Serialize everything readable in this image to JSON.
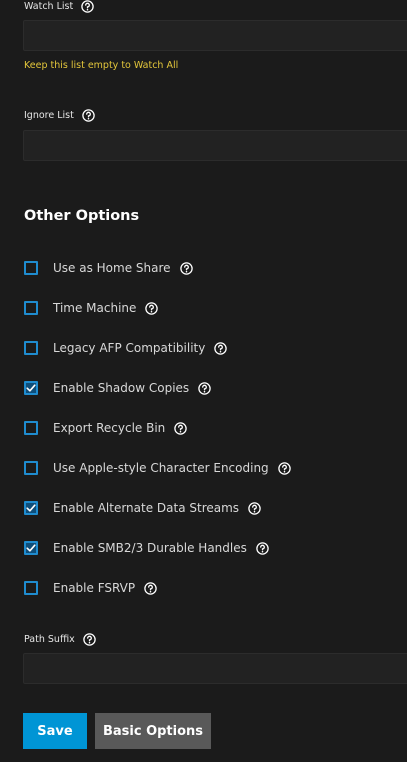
{
  "watch_list": {
    "label": "Watch List",
    "value": "",
    "hint": "Keep this list empty to Watch All"
  },
  "ignore_list": {
    "label": "Ignore List",
    "value": ""
  },
  "other_options": {
    "title": "Other Options",
    "items": [
      {
        "label": "Use as Home Share",
        "checked": false
      },
      {
        "label": "Time Machine",
        "checked": false
      },
      {
        "label": "Legacy AFP Compatibility",
        "checked": false
      },
      {
        "label": "Enable Shadow Copies",
        "checked": true
      },
      {
        "label": "Export Recycle Bin",
        "checked": false
      },
      {
        "label": "Use Apple-style Character Encoding",
        "checked": false
      },
      {
        "label": "Enable Alternate Data Streams",
        "checked": true
      },
      {
        "label": "Enable SMB2/3 Durable Handles",
        "checked": true
      },
      {
        "label": "Enable FSRVP",
        "checked": false
      }
    ]
  },
  "path_suffix": {
    "label": "Path Suffix",
    "value": ""
  },
  "actions": {
    "save_label": "Save",
    "basic_options_label": "Basic Options"
  },
  "colors": {
    "background": "#1b1b1b",
    "input_background": "#222222",
    "accent": "#0095d5",
    "checkbox_border": "#1f8ccf",
    "hint": "#e3c63b",
    "secondary_button": "#595959"
  },
  "icons": {
    "help": "help-circle-icon",
    "check": "checkmark-icon"
  }
}
